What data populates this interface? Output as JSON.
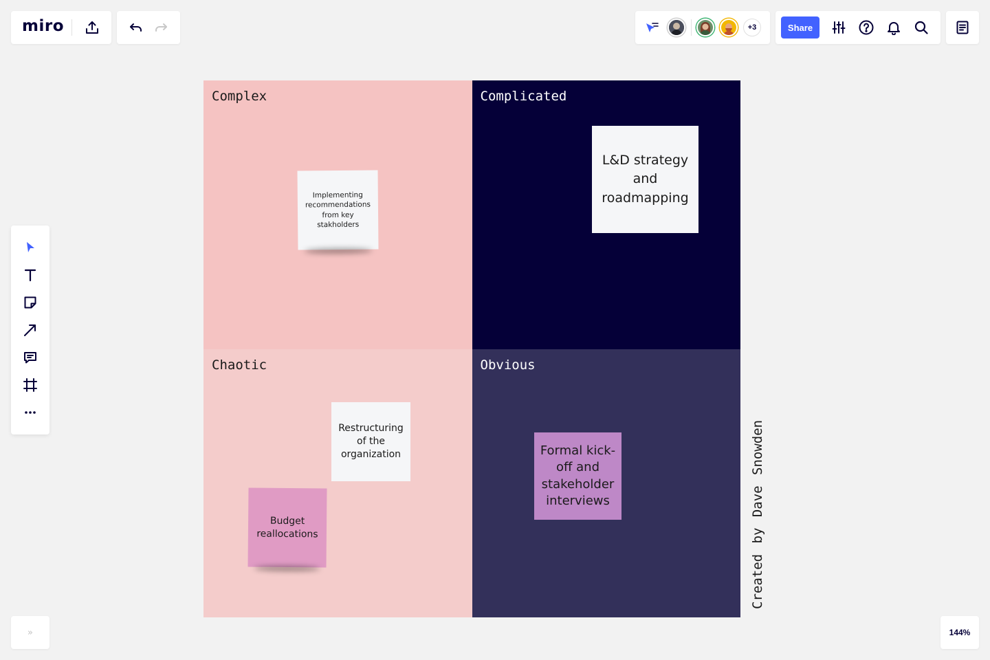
{
  "app": {
    "logo": "miro",
    "export_icon": "upload-icon",
    "undo_icon": "undo-icon",
    "redo_icon": "redo-icon"
  },
  "collaboration": {
    "cursor_icon": "collaborator-cursors-icon",
    "avatars": [
      "user-avatar-1",
      "user-avatar-2",
      "user-avatar-3"
    ],
    "more_count": "+3"
  },
  "toolbar_right": {
    "share_label": "Share",
    "icons": [
      "settings-sliders-icon",
      "help-icon",
      "bell-icon",
      "search-icon"
    ],
    "notes_icon": "board-notes-icon"
  },
  "left_toolbar": {
    "tools": [
      "select-cursor-icon",
      "text-icon",
      "sticky-note-icon",
      "line-arrow-icon",
      "comment-icon",
      "frame-icon",
      "more-icon"
    ]
  },
  "bottom": {
    "expand_label": "»",
    "zoom": "144%"
  },
  "board": {
    "quadrants": {
      "complex": "Complex",
      "complicated": "Complicated",
      "chaotic": "Chaotic",
      "obvious": "Obvious"
    },
    "stickies": {
      "complex_1": "Implementing recommendations from key stakholders",
      "complicated_1": "L&D strategy and roadmapping",
      "chaotic_1": "Restructuring of the organization",
      "chaotic_2": "Budget reallocations",
      "obvious_1": "Formal kick-off and stakeholder interviews"
    },
    "credit": "Created by Dave Snowden"
  },
  "colors": {
    "accent": "#4262ff",
    "complex_bg": "#f5c3c2",
    "complicated_bg": "#050038",
    "chaotic_bg": "#f4cccb",
    "obvious_bg": "#33305a",
    "sticky_white": "#f5f6f8",
    "sticky_pink": "#e09bc4",
    "sticky_violet": "#be88c7"
  }
}
